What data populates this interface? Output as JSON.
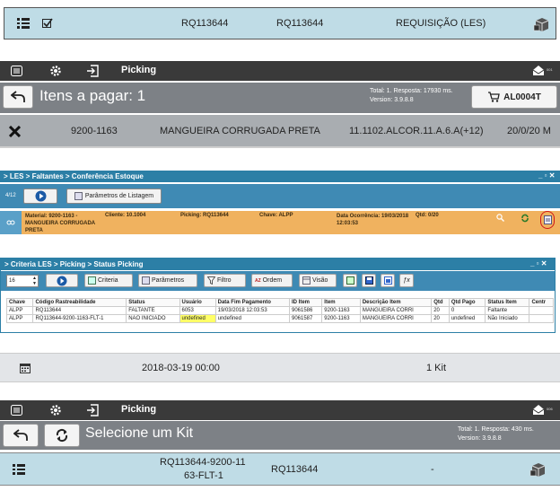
{
  "row1": {
    "req_a": "RQ113644",
    "req_b": "RQ113644",
    "type": "REQUISIÇÃO (LES)"
  },
  "header1": {
    "title": "Picking",
    "badge": "001"
  },
  "bar1": {
    "title": "Itens a pagar: 1",
    "total": "Total: 1. Resposta: 17930 ms.",
    "version": "Version: 3.9.8.8",
    "cart_label": "AL0004T"
  },
  "item1": {
    "code": "9200-1163",
    "desc": "MANGUEIRA CORRUGADA PRETA",
    "location": "11.1102.ALCOR.11.A.6.A(+12)",
    "qty": "20/0/20 M"
  },
  "panel1": {
    "breadcrumb": "> LES > Faltantes > Conferência Estoque",
    "left_val": "4/12",
    "params_label": "Parâmetros de Listagem"
  },
  "info1": {
    "material": "Material: 9200-1163 - MANGUEIRA CORRUGADA PRETA",
    "cliente": "Cliente: 10.1004",
    "picking": "Picking: RQ113644",
    "chave": "Chave: ALPP",
    "data": "Data Ocorrência: 19/03/2018 12:03:53",
    "qtd": "Qtd: 0/20"
  },
  "panel2": {
    "breadcrumb": "> Criteria LES > Picking > Status Picking",
    "page_val": "16",
    "criteria": "Criteria",
    "parametros": "Parâmetros",
    "filtro": "Filtro",
    "ordem": "Ordem",
    "visao": "Visão"
  },
  "table": {
    "headers": [
      "Chave",
      "Código Rastreabilidade",
      "Status",
      "Usuário",
      "Data Fim Pagamento",
      "ID Item",
      "Item",
      "Descrição Item",
      "Qtd",
      "Qtd Pago",
      "Status Item",
      "Centr"
    ],
    "rows": [
      [
        "ALPP",
        "RQ113644",
        "FALTANTE",
        "6053",
        "19/03/2018 12:03:53",
        "9061586",
        "9200-1163",
        "MANGUEIRA CORRI",
        "20",
        "0",
        "Faltante",
        ""
      ],
      [
        "ALPP",
        "RQ113644-9200-1163-FLT-1",
        "NÃO INICIADO",
        "undefined",
        "undefined",
        "9061587",
        "9200-1163",
        "MANGUEIRA CORRI",
        "20",
        "undefined",
        "Não Iniciado",
        ""
      ]
    ]
  },
  "row_date": {
    "date": "2018-03-19 00:00",
    "kit": "1 Kit"
  },
  "header2": {
    "title": "Picking",
    "badge": "006"
  },
  "bar2": {
    "title": "Selecione um Kit",
    "total": "Total: 1. Resposta: 430 ms.",
    "version": "Version: 3.9.8.8"
  },
  "row_last": {
    "code_a": "RQ113644-9200-11",
    "code_b": "63-FLT-1",
    "req": "RQ113644",
    "dash": "-"
  }
}
